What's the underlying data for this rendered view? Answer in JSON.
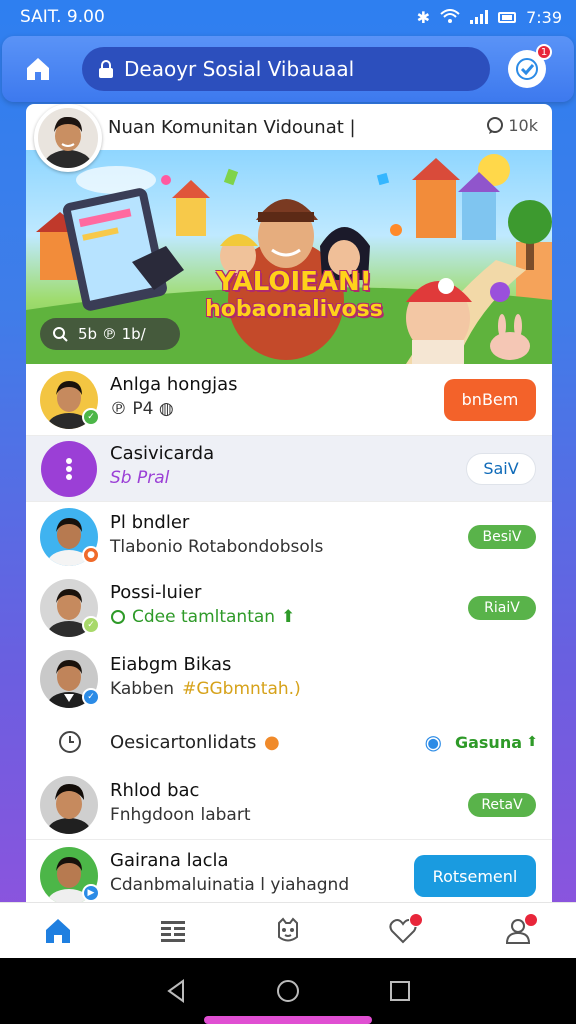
{
  "status_bar": {
    "left_text": "SAIT. 9.00",
    "time": "7:39"
  },
  "header": {
    "search_text": "Deaoyr Sosial Vibauaal",
    "notification_count": "1"
  },
  "card": {
    "title": "Nuan Komunitan Vidounat |",
    "count": "10k",
    "banner": {
      "headline_line1": "YALOIEAN!",
      "headline_line2": "hobaonalivoss",
      "pill_text": "5b  ℗ 1b/"
    }
  },
  "rows": [
    {
      "name": "Anlga hongjas",
      "sub": "℗ P4 ◍",
      "button": "bnBem",
      "button_style": "orange"
    },
    {
      "name": "Casivicarda",
      "sub": "Sb Pral",
      "button": "SaiV",
      "button_style": "white",
      "sub_color": "#9b3fd6"
    },
    {
      "name": "Pl bndler",
      "sub": "Tlabonio Rotabondobsols",
      "button": "BesiV",
      "button_style": "green"
    },
    {
      "name": "Possi-luier",
      "sub": "Cdee tamltantan",
      "button": "RiaiV",
      "button_style": "green",
      "sub_color": "#2e9a28"
    },
    {
      "name": "Eiabgm Bikas",
      "sub": "Kabben",
      "sub_extra": "#GGbmntah.)",
      "button": "",
      "button_style": "none"
    },
    {
      "name": "Rhlod bac",
      "sub": "Fnhgdoon",
      "sub_extra": "labart",
      "button": "RetaV",
      "button_style": "green"
    },
    {
      "name": "Gairana lacla",
      "sub": "Cdanbmaluinatia l yiahagnd",
      "button": "Rotsemenl",
      "button_style": "blue"
    }
  ],
  "info_row": {
    "text": "Oesicartonlidats",
    "right_text": "Gasuna"
  },
  "bottom_nav": {
    "items": [
      "home",
      "feed",
      "groups",
      "likes",
      "profile"
    ]
  },
  "colors": {
    "accent": "#3d79ee",
    "orange": "#f3622a",
    "green": "#59b34a",
    "blue": "#1a9be0",
    "purple": "#9b3fd6"
  }
}
